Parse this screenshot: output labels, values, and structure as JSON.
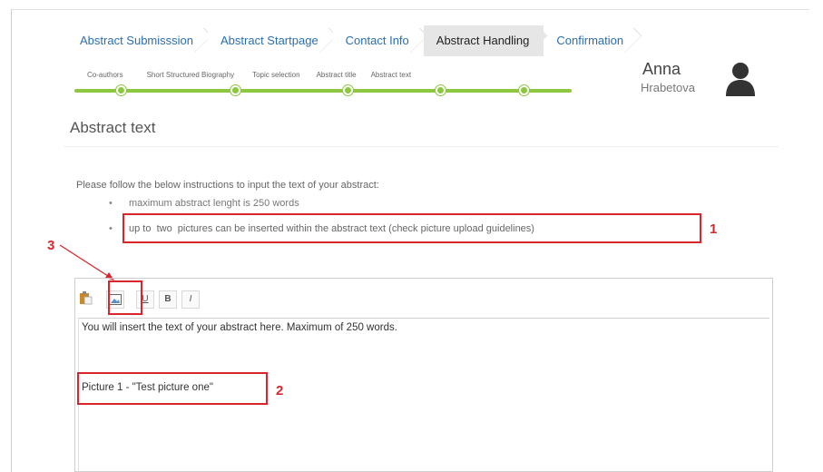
{
  "tabs": [
    {
      "label": "Abstract Submisssion"
    },
    {
      "label": "Abstract Startpage"
    },
    {
      "label": "Contact Info"
    },
    {
      "label": "Abstract Handling"
    },
    {
      "label": "Confirmation"
    }
  ],
  "active_tab": "Abstract Handling",
  "steps": [
    {
      "label": "Co-authors"
    },
    {
      "label": "Short Structured Biography"
    },
    {
      "label": "Topic selection"
    },
    {
      "label": "Abstract title"
    },
    {
      "label": "Abstract text"
    }
  ],
  "user": {
    "first_name": "Anna",
    "last_name": "Hrabetova"
  },
  "page": {
    "title": "Abstract text"
  },
  "instructions": {
    "intro": "Please follow the below instructions to input the text of your abstract:",
    "bullets": [
      "maximum abstract lenght is 250 words",
      "up to  two  pictures can be inserted within the abstract text (check picture upload guidelines)"
    ]
  },
  "editor": {
    "toolbar": {
      "paste_icon": "clipboard-icon",
      "image_icon": "image-icon",
      "underline_label": "U",
      "bold_label": "B",
      "italic_label": "I"
    },
    "content": "You will insert the text of your abstract here. Maximum of 250 words.",
    "picture_caption": "Picture 1 - \"Test picture one\""
  },
  "annotations": {
    "one": "1",
    "two": "2",
    "three": "3"
  },
  "colors": {
    "accent_green": "#8dc63f",
    "link_blue": "#2a6fb0",
    "annotation_red": "#d8262c"
  }
}
